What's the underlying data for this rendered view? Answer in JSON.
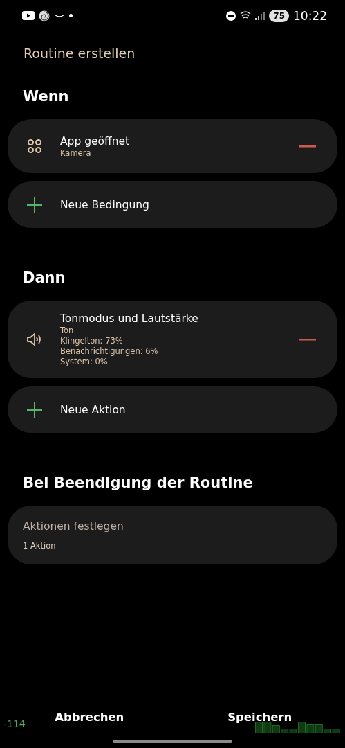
{
  "status_bar": {
    "time": "10:22",
    "battery": "75"
  },
  "title": "Routine erstellen",
  "sections": [
    {
      "heading": "Wenn",
      "items": [
        {
          "kind": "entry",
          "title": "App geöffnet",
          "details": [
            "Kamera"
          ]
        },
        {
          "kind": "add",
          "title": "Neue Bedingung"
        }
      ]
    },
    {
      "heading": "Dann",
      "items": [
        {
          "kind": "entry",
          "title": "Tonmodus und Lautstärke",
          "details": [
            "Ton",
            "Klingelton: 73%",
            "Benachrichtigungen: 6%",
            "System: 0%"
          ]
        },
        {
          "kind": "add",
          "title": "Neue Aktion"
        }
      ]
    },
    {
      "heading": "Bei Beendigung der Routine",
      "items": [
        {
          "kind": "summary",
          "title": "Aktionen festlegen",
          "details": [
            "1 Aktion"
          ]
        }
      ]
    }
  ],
  "buttons": [
    "Abbrechen",
    "Speichern"
  ],
  "overlay": {
    "reading": "-114"
  }
}
